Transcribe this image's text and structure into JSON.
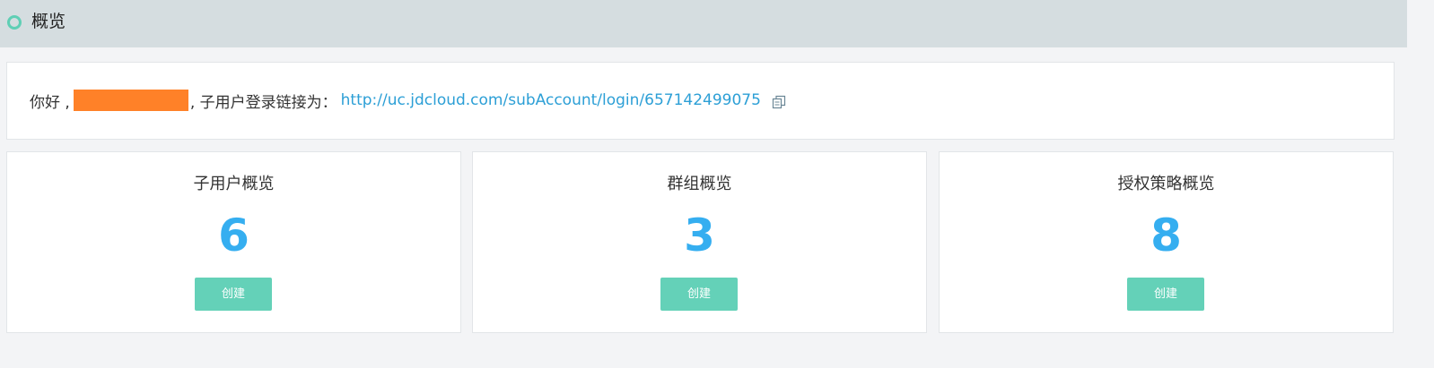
{
  "header": {
    "title": "概览",
    "indicator_color": "#5fcfb5"
  },
  "welcome": {
    "greeting": "你好 ,",
    "redacted_color": "#ff8128",
    "text": ", 子用户登录链接为：",
    "link": "http://uc.jdcloud.com/subAccount/login/657142499075",
    "copy_icon": "copy-icon"
  },
  "cards": [
    {
      "title": "子用户概览",
      "count": "6",
      "button_label": "创建"
    },
    {
      "title": "群组概览",
      "count": "3",
      "button_label": "创建"
    },
    {
      "title": "授权策略概览",
      "count": "8",
      "button_label": "创建"
    }
  ],
  "colors": {
    "count": "#35aef0",
    "button": "#64d1b8",
    "link": "#2c9fd6"
  }
}
